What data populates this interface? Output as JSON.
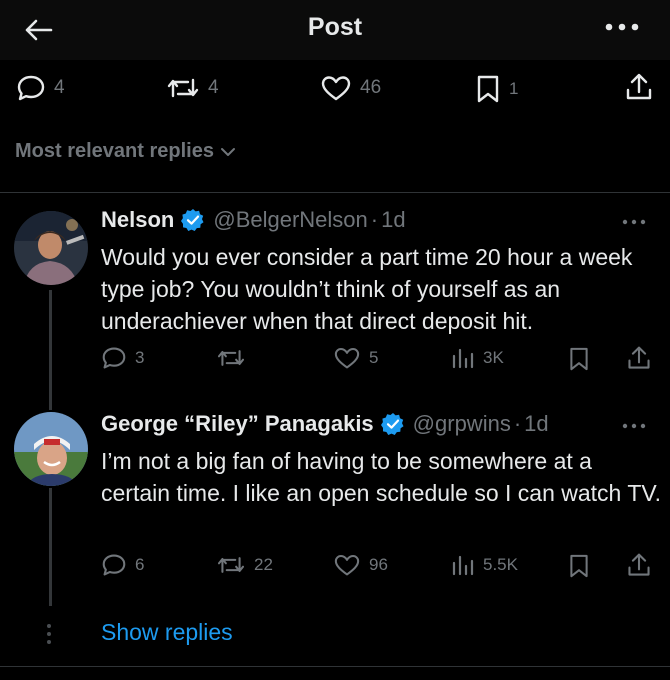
{
  "header": {
    "title": "Post"
  },
  "post_stats": {
    "replies": "4",
    "reposts": "4",
    "likes": "46",
    "bookmarks": "1"
  },
  "sort": {
    "label": "Most relevant replies"
  },
  "replies": [
    {
      "name": "Nelson",
      "handle": "@BelgerNelson",
      "separator": "·",
      "time": "1d",
      "text": "Would you ever consider a part time 20 hour a week type job? You wouldn’t think of yourself as an underachiever when that direct deposit hit.",
      "stats": {
        "replies": "3",
        "reposts": "",
        "likes": "5",
        "views": "3K"
      }
    },
    {
      "name": "George “Riley” Panagakis",
      "handle": "@grpwins",
      "separator": "·",
      "time": "1d",
      "text": "I’m not a big fan of having to be somewhere at a certain time. I like an open schedule so I can watch TV.",
      "stats": {
        "replies": "6",
        "reposts": "22",
        "likes": "96",
        "views": "5.5K"
      }
    }
  ],
  "footer": {
    "show_replies": "Show replies"
  },
  "colors": {
    "background": "#000000",
    "text": "#e7e9ea",
    "muted": "#71767b",
    "accent": "#1d9bf0"
  }
}
